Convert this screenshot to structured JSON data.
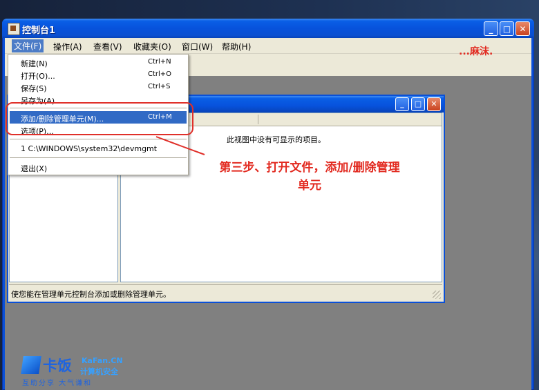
{
  "window": {
    "title": "控制台1",
    "min_glyph": "_",
    "max_glyph": "□",
    "close_glyph": "✕"
  },
  "menubar": {
    "items": [
      {
        "label": "文件(F)"
      },
      {
        "label": "操作(A)"
      },
      {
        "label": "查看(V)"
      },
      {
        "label": "收藏夹(O)"
      },
      {
        "label": "窗口(W)"
      },
      {
        "label": "帮助(H)"
      }
    ]
  },
  "file_menu": {
    "items": [
      {
        "label": "新建(N)",
        "shortcut": "Ctrl+N"
      },
      {
        "label": "打开(O)...",
        "shortcut": "Ctrl+O"
      },
      {
        "label": "保存(S)",
        "shortcut": "Ctrl+S"
      },
      {
        "label": "另存为(A)...",
        "shortcut": ""
      },
      {
        "label": "添加/删除管理单元(M)...",
        "shortcut": "Ctrl+M"
      },
      {
        "label": "选项(P)...",
        "shortcut": ""
      },
      {
        "label": "1 C:\\WINDOWS\\system32\\devmgmt",
        "shortcut": ""
      },
      {
        "label": "退出(X)",
        "shortcut": ""
      }
    ]
  },
  "console_root": {
    "empty_message": "此视图中没有可显示的项目。",
    "status": "使您能在管理单元控制台添加或删除管理单元。"
  },
  "annotations": {
    "step_line1": "第三步、打开文件，添加/删除管理",
    "step_line2": "单元",
    "author": "...麻沫.",
    "color": "#e22a20"
  },
  "watermark": {
    "name": "卡饭",
    "domain": "KaFan.CN",
    "sub": "计算机安全",
    "slogan": "互助分享  大气谦和"
  }
}
